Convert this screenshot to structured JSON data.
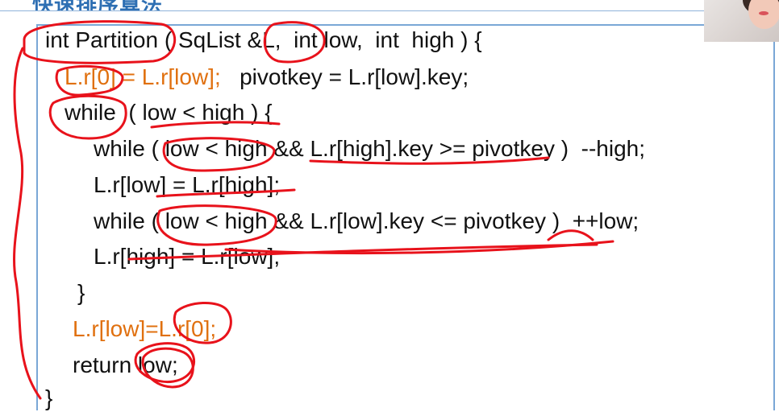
{
  "slide": {
    "title": "快速排序算法"
  },
  "code": {
    "line1": "int Partition ( SqList &L,  int low,  int  high ) {",
    "line2_a": "L.r[0] = L.r[low];",
    "line2_b": "   pivotkey = L.r[low].key;",
    "line3": "while  ( low < high ) {",
    "line4": "while ( low < high && L.r[high].key >= pivotkey )  --high;",
    "line5": "L.r[low] = L.r[high];",
    "line6": "while ( low < high && L.r[low].key <= pivotkey )  ++low;",
    "line7": "L.r[high] = L.r[low];",
    "line8": "}",
    "line9": "L.r[low]=L.r[0];",
    "line10": "return low;",
    "line11": "}"
  },
  "colors": {
    "accent_orange": "#e0700f",
    "box_border": "#7aa7d6",
    "ink_red": "#e8121b"
  }
}
